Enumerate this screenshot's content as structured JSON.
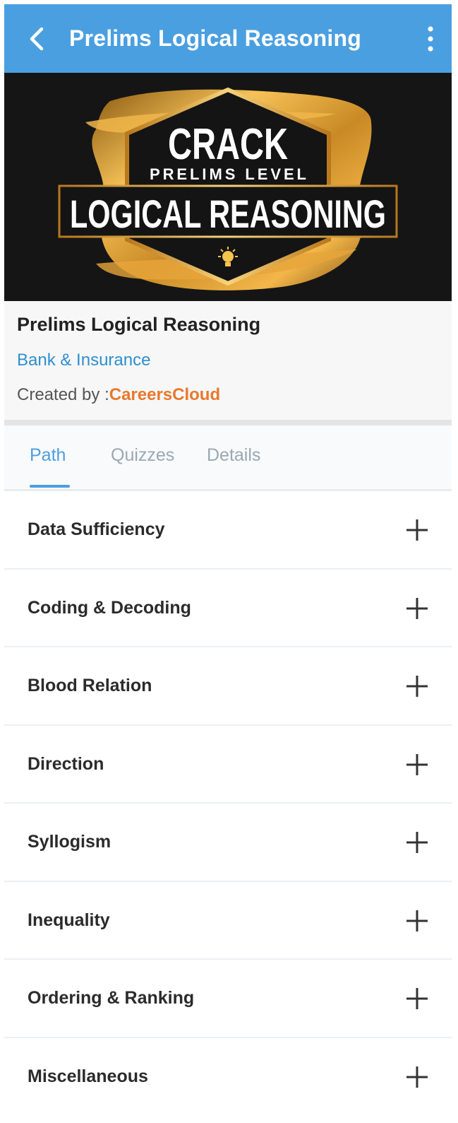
{
  "appbar": {
    "title": "Prelims Logical Reasoning",
    "back_icon": "chevron-left-icon",
    "menu_icon": "more-vert-icon",
    "color": "#4a9fe0"
  },
  "banner": {
    "line1": "CRACK",
    "line2": "PRELIMS LEVEL",
    "line3": "LOGICAL REASONING",
    "icon": "lightbulb-icon"
  },
  "course": {
    "title": "Prelims Logical Reasoning",
    "category": "Bank & Insurance",
    "created_by_label": "Created by :",
    "creator": "CareersCloud"
  },
  "tabs": [
    {
      "label": "Path",
      "active": true
    },
    {
      "label": "Quizzes",
      "active": false
    },
    {
      "label": "Details",
      "active": false
    }
  ],
  "path_items": [
    {
      "label": "Data Sufficiency"
    },
    {
      "label": "Coding & Decoding"
    },
    {
      "label": "Blood Relation"
    },
    {
      "label": "Direction"
    },
    {
      "label": "Syllogism"
    },
    {
      "label": "Inequality"
    },
    {
      "label": "Ordering & Ranking"
    },
    {
      "label": "Miscellaneous"
    }
  ],
  "colors": {
    "accent": "#4a9fe0",
    "category": "#2f8fcf",
    "creator": "#e9782d",
    "gold": "#e2a53a"
  }
}
